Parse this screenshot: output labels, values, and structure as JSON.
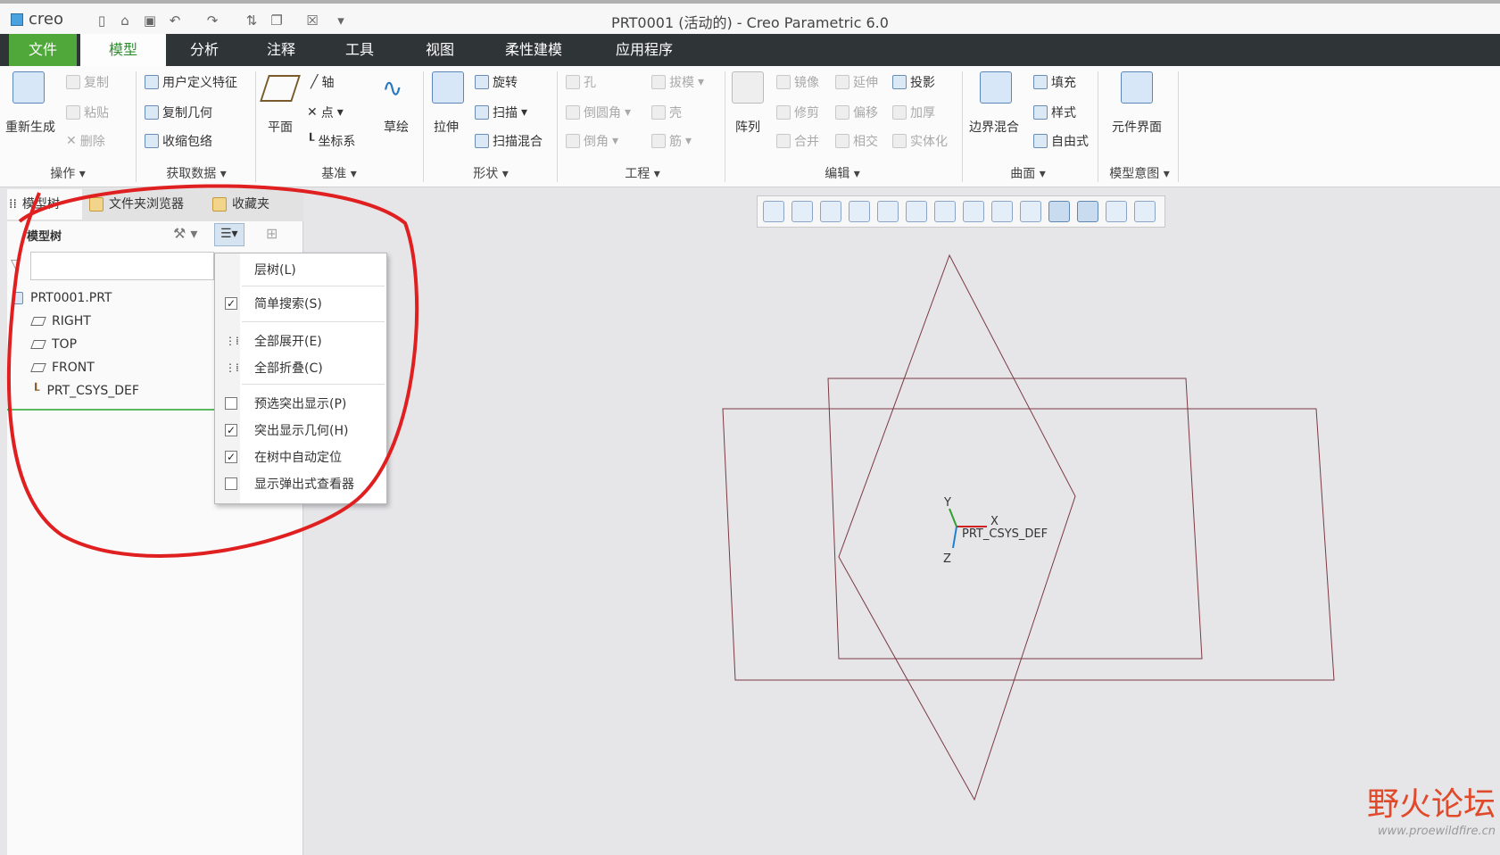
{
  "app": {
    "logo_text": "creo",
    "window_title": "PRT0001 (活动的) - Creo Parametric 6.0"
  },
  "menubar": {
    "items": [
      "文件",
      "模型",
      "分析",
      "注释",
      "工具",
      "视图",
      "柔性建模",
      "应用程序"
    ]
  },
  "ribbon": {
    "operations": {
      "regenerate": "重新生成",
      "copy": "复制",
      "paste": "粘贴",
      "delete": "删除",
      "group": "操作"
    },
    "get_data": {
      "udf": "用户定义特征",
      "copy_geom": "复制几何",
      "shrinkwrap": "收缩包络",
      "group": "获取数据"
    },
    "datum": {
      "plane": "平面",
      "axis": "轴",
      "point": "点",
      "csys": "坐标系",
      "sketch": "草绘",
      "group": "基准"
    },
    "shapes": {
      "extrude": "拉伸",
      "revolve": "旋转",
      "sweep": "扫描",
      "swept_blend": "扫描混合",
      "group": "形状"
    },
    "engineering": {
      "hole": "孔",
      "round": "倒圆角",
      "chamfer": "倒角",
      "draft": "拔模",
      "shell": "壳",
      "rib": "筋",
      "group": "工程"
    },
    "editing": {
      "pattern": "阵列",
      "mirror": "镜像",
      "trim": "修剪",
      "merge": "合并",
      "extend": "延伸",
      "offset": "偏移",
      "intersect": "相交",
      "project": "投影",
      "thicken": "加厚",
      "solidify": "实体化",
      "group": "编辑"
    },
    "surfaces": {
      "boundary_blend": "边界混合",
      "fill": "填充",
      "style": "样式",
      "freestyle": "自由式",
      "group": "曲面"
    },
    "model_intent": {
      "component_interface": "元件界面",
      "group": "模型意图"
    }
  },
  "left_panel": {
    "tabs": [
      "模型树",
      "文件夹浏览器",
      "收藏夹"
    ],
    "header": "模型树",
    "filter_placeholder": "",
    "tree": {
      "root": "PRT0001.PRT",
      "items": [
        "RIGHT",
        "TOP",
        "FRONT",
        "PRT_CSYS_DEF"
      ]
    }
  },
  "dropdown": {
    "items": [
      {
        "label": "层树(L)",
        "kind": "none"
      },
      {
        "label": "简单搜索(S)",
        "kind": "check",
        "checked": true
      },
      {
        "label": "全部展开(E)",
        "kind": "icon"
      },
      {
        "label": "全部折叠(C)",
        "kind": "icon"
      },
      {
        "label": "预选突出显示(P)",
        "kind": "check",
        "checked": false
      },
      {
        "label": "突出显示几何(H)",
        "kind": "check",
        "checked": true
      },
      {
        "label": "在树中自动定位",
        "kind": "check",
        "checked": true
      },
      {
        "label": "显示弹出式查看器",
        "kind": "check",
        "checked": false
      }
    ]
  },
  "viewport": {
    "csys_label": "PRT_CSYS_DEF",
    "axis_x": "X",
    "axis_y": "Y",
    "axis_z": "Z",
    "plane_color": "#7a3a42"
  },
  "watermark": {
    "title": "野火论坛",
    "url": "www.proewildfire.cn"
  },
  "colors": {
    "file_tab": "#50a83a",
    "menubar_bg": "#2f3437",
    "annotation_circle": "#e02020"
  }
}
